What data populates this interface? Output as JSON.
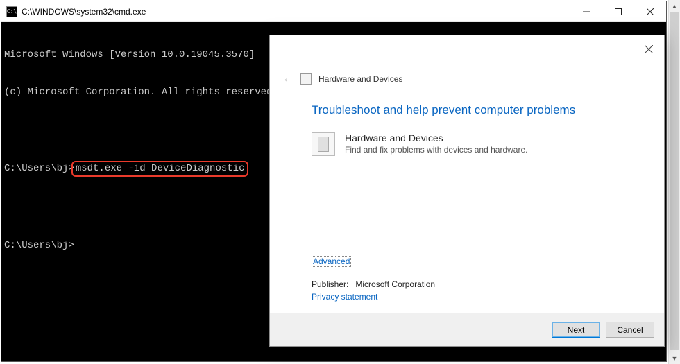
{
  "cmd": {
    "icon_text": "C:\\",
    "title": "C:\\WINDOWS\\system32\\cmd.exe",
    "line1": "Microsoft Windows [Version 10.0.19045.3570]",
    "line2": "(c) Microsoft Corporation. All rights reserved.",
    "prompt1_prefix": "C:\\Users\\bj>",
    "highlighted_command": "msdt.exe -id DeviceDiagnostic",
    "prompt2": "C:\\Users\\bj>"
  },
  "dialog": {
    "header_title": "Hardware and Devices",
    "heading": "Troubleshoot and help prevent computer problems",
    "item_title": "Hardware and Devices",
    "item_desc": "Find and fix problems with devices and hardware.",
    "advanced_label": "Advanced",
    "publisher_label": "Publisher:",
    "publisher_value": "Microsoft Corporation",
    "privacy_label": "Privacy statement",
    "next_label": "Next",
    "cancel_label": "Cancel"
  }
}
